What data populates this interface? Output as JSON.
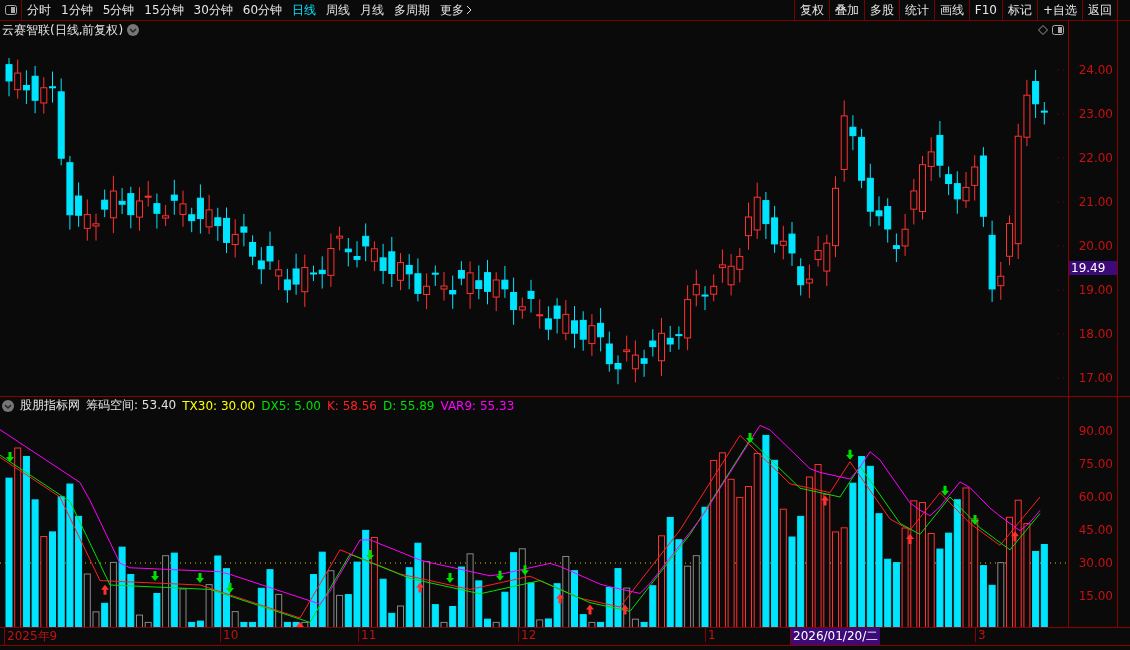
{
  "toolbar": {
    "periods": [
      {
        "label": "分时",
        "selected": false
      },
      {
        "label": "1分钟",
        "selected": false
      },
      {
        "label": "5分钟",
        "selected": false
      },
      {
        "label": "15分钟",
        "selected": false
      },
      {
        "label": "30分钟",
        "selected": false
      },
      {
        "label": "60分钟",
        "selected": false
      },
      {
        "label": "日线",
        "selected": true
      },
      {
        "label": "周线",
        "selected": false
      },
      {
        "label": "月线",
        "selected": false
      },
      {
        "label": "多周期",
        "selected": false
      }
    ],
    "more": "更多",
    "actions": [
      "复权",
      "叠加",
      "多股",
      "统计",
      "画线",
      "F10",
      "标记",
      "+自选",
      "返回"
    ]
  },
  "price_chart": {
    "title": "云赛智联(日线,前复权)",
    "yticks": [
      "24.00",
      "23.00",
      "22.00",
      "21.00",
      "20.00",
      "19.00",
      "18.00",
      "17.00"
    ],
    "current_price": "19.49"
  },
  "indicator": {
    "name": "股朋指标网",
    "values": [
      {
        "label": "筹码空间: 53.40",
        "color": "#e0e0e0"
      },
      {
        "label": "TX30: 30.00",
        "color": "#ffff00"
      },
      {
        "label": "DX5: 5.00",
        "color": "#00e000"
      },
      {
        "label": "K: 58.56",
        "color": "#ff2020"
      },
      {
        "label": "D: 55.89",
        "color": "#00e000"
      },
      {
        "label": "VAR9: 55.33",
        "color": "#ff00ff"
      }
    ],
    "yticks": [
      "90.00",
      "75.00",
      "60.00",
      "45.00",
      "30.00",
      "15.00"
    ]
  },
  "date_axis": [
    {
      "label": "2025年9",
      "selected": false
    },
    {
      "label": "10",
      "selected": false
    },
    {
      "label": "11",
      "selected": false
    },
    {
      "label": "12",
      "selected": false
    },
    {
      "label": "1",
      "selected": false
    },
    {
      "label": "2026/01/20/二",
      "selected": true
    },
    {
      "label": "3",
      "selected": false
    }
  ]
}
